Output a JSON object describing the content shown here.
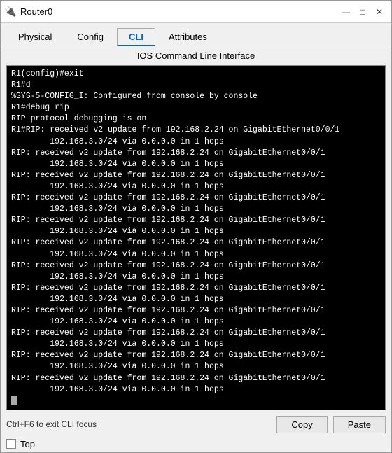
{
  "window": {
    "title": "Router0",
    "icon": "🔌"
  },
  "titlebar": {
    "minimize_label": "—",
    "maximize_label": "□",
    "close_label": "✕"
  },
  "tabs": [
    {
      "id": "physical",
      "label": "Physical"
    },
    {
      "id": "config",
      "label": "Config"
    },
    {
      "id": "cli",
      "label": "CLI"
    },
    {
      "id": "attributes",
      "label": "Attributes"
    }
  ],
  "active_tab": "cli",
  "section_title": "IOS Command Line Interface",
  "terminal_content": "R1(config)#exit\nR1#d\n%SYS-5-CONFIG_I: Configured from console by console\nR1#debug rip\nRIP protocol debugging is on\nR1#RIP: received v2 update from 192.168.2.24 on GigabitEthernet0/0/1\n        192.168.3.0/24 via 0.0.0.0 in 1 hops\nRIP: received v2 update from 192.168.2.24 on GigabitEthernet0/0/1\n        192.168.3.0/24 via 0.0.0.0 in 1 hops\nRIP: received v2 update from 192.168.2.24 on GigabitEthernet0/0/1\n        192.168.3.0/24 via 0.0.0.0 in 1 hops\nRIP: received v2 update from 192.168.2.24 on GigabitEthernet0/0/1\n        192.168.3.0/24 via 0.0.0.0 in 1 hops\nRIP: received v2 update from 192.168.2.24 on GigabitEthernet0/0/1\n        192.168.3.0/24 via 0.0.0.0 in 1 hops\nRIP: received v2 update from 192.168.2.24 on GigabitEthernet0/0/1\n        192.168.3.0/24 via 0.0.0.0 in 1 hops\nRIP: received v2 update from 192.168.2.24 on GigabitEthernet0/0/1\n        192.168.3.0/24 via 0.0.0.0 in 1 hops\nRIP: received v2 update from 192.168.2.24 on GigabitEthernet0/0/1\n        192.168.3.0/24 via 0.0.0.0 in 1 hops\nRIP: received v2 update from 192.168.2.24 on GigabitEthernet0/0/1\n        192.168.3.0/24 via 0.0.0.0 in 1 hops\nRIP: received v2 update from 192.168.2.24 on GigabitEthernet0/0/1\n        192.168.3.0/24 via 0.0.0.0 in 1 hops\nRIP: received v2 update from 192.168.2.24 on GigabitEthernet0/0/1\n        192.168.3.0/24 via 0.0.0.0 in 1 hops\nRIP: received v2 update from 192.168.2.24 on GigabitEthernet0/0/1\n        192.168.3.0/24 via 0.0.0.0 in 1 hops",
  "bottom_bar": {
    "hint_text": "Ctrl+F6 to exit CLI focus",
    "copy_label": "Copy",
    "paste_label": "Paste"
  },
  "footer": {
    "top_label": "Top",
    "checkbox_checked": false
  }
}
